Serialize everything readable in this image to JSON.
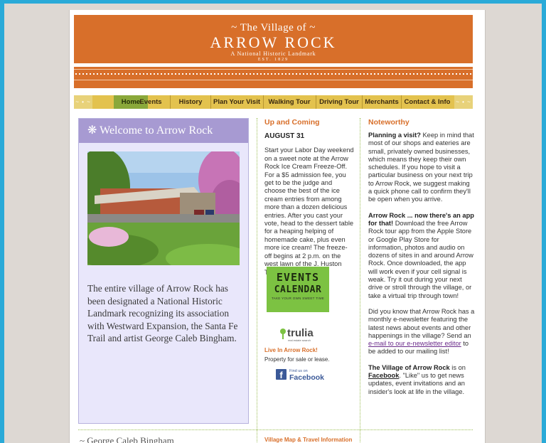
{
  "header": {
    "top_line": "~ The Village of ~",
    "title": "ARROW ROCK",
    "subtitle": "A National Historic Landmark",
    "established": "EST. 1829"
  },
  "nav": {
    "left_cap": "~ • ~",
    "right_cap": "~ • ~",
    "items": [
      "Home",
      "Events",
      "History",
      "Plan Your Visit",
      "Walking Tour",
      "Driving Tour",
      "Merchants",
      "Contact & Info"
    ],
    "active": "Home"
  },
  "welcome": {
    "heading_icon": "❋",
    "heading": "Welcome to Arrow Rock",
    "intro": "The entire village of Arrow Rock has been designated a National Historic Landmark recognizing its association with Westward Expansion, the Santa Fe Trail and artist George Caleb Bingham."
  },
  "upcoming": {
    "heading": "Up and Coming",
    "date": "AUGUST 31",
    "body": "Start your Labor Day weekend on a sweet note at the Arrow Rock Ice Cream Freeze-Off. For a $5 admission fee, you get to be the judge and choose the best of the ice cream entries from among more than a dozen delicious entries. After you cast your vote, head to the dessert table for a heaping helping of homemade cake, plus even more ice cream! The freeze-off begins at 2 p.m. on the west lawn of the J. Huston Tavern.",
    "events_badge_line1": "EVENTS",
    "events_badge_line2": "CALENDAR",
    "events_badge_tagline": "TAKE YOUR OWN SWEET TIME",
    "trulia_logo": "trulia",
    "trulia_tagline": "real estate search",
    "live_link": "Live In Arrow Rock!",
    "property_text": "Property for sale or lease.",
    "fb_small": "Find us on",
    "fb_big": "Facebook"
  },
  "noteworthy": {
    "heading": "Noteworthy",
    "p1_bold": "Planning a visit?",
    "p1": " Keep in mind that most of our shops and eateries are small, privately owned businesses, which means they keep their own schedules. If you hope to visit a particular business on your next trip to Arrow Rock, we suggest making a quick phone call to confirm they'll be open when you arrive.",
    "p2_bold": "Arrow Rock ... now there's an app for that!",
    "p2": " Download the free Arrow Rock tour app from the Apple Store or Google Play Store for information, photos and audio on dozens of sites in and around Arrow Rock. Once downloaded, the app will work even if your cell signal is weak. Try it out during your next drive or stroll through the village, or take a virtual trip through town!",
    "p3_a": "Did you know that Arrow Rock has a monthly e-newsletter featuring the latest news about events and other happenings in the village? Send an ",
    "p3_link": "e-mail to our e-newsletter editor",
    "p3_b": " to be added to our mailing list!",
    "p4_bold": "The Village of Arrow Rock",
    "p4_mid": " is on ",
    "p4_link": "Facebook",
    "p4_rest": ". \"Like\" us to get news updates, event invitations and an insider's look at life in the village."
  },
  "bottom": {
    "left_partial": "~ George Caleb Bingham",
    "mid_partial": "Village Map & Travel Information"
  },
  "colors": {
    "brand_orange": "#d86f2a",
    "nav_gold": "#e3c24e",
    "nav_active": "#8aa83a",
    "lavender": "#a79ad2",
    "outer_border": "#2aaad8"
  }
}
